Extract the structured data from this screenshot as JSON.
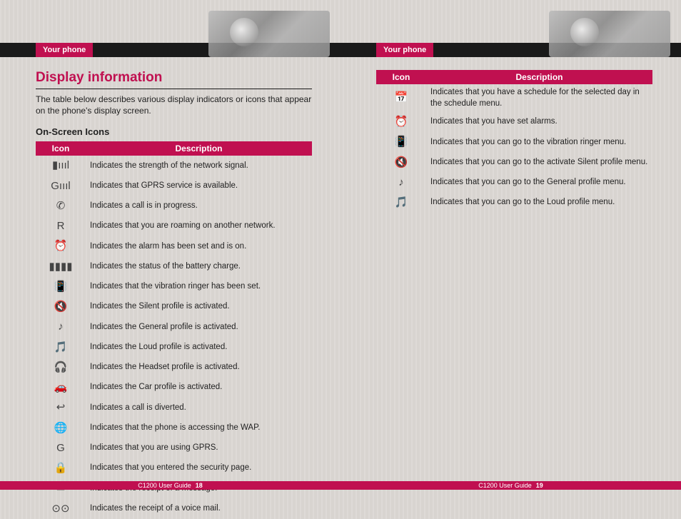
{
  "header": {
    "label": "Your phone"
  },
  "left": {
    "title": "Display information",
    "intro": "The table below describes various display indicators or icons that appear on the phone's display screen.",
    "subhead": "On-Screen Icons",
    "table": {
      "col_icon": "Icon",
      "col_desc": "Description",
      "rows": [
        {
          "icon": "signal-strength-icon",
          "glyph": "▮ıııl",
          "desc": "Indicates the strength of the network signal."
        },
        {
          "icon": "gprs-signal-icon",
          "glyph": "Gıııl",
          "desc": "Indicates that GPRS service is available."
        },
        {
          "icon": "call-in-progress-icon",
          "glyph": "✆",
          "desc": "Indicates a call is in progress."
        },
        {
          "icon": "roaming-icon",
          "glyph": "R",
          "desc": "Indicates that you are roaming on another network."
        },
        {
          "icon": "alarm-on-icon",
          "glyph": "⏰",
          "desc": "Indicates the alarm has been set and is on."
        },
        {
          "icon": "battery-icon",
          "glyph": "▮▮▮▮",
          "desc": "Indicates the status of the battery charge."
        },
        {
          "icon": "vibration-ringer-icon",
          "glyph": "📳",
          "desc": "Indicates that the vibration ringer has been set."
        },
        {
          "icon": "silent-profile-icon",
          "glyph": "🔇",
          "desc": "Indicates the Silent profile is activated."
        },
        {
          "icon": "general-profile-icon",
          "glyph": "♪",
          "desc": "Indicates the General profile is activated."
        },
        {
          "icon": "loud-profile-icon",
          "glyph": "🎵",
          "desc": "Indicates the Loud profile is activated."
        },
        {
          "icon": "headset-profile-icon",
          "glyph": "🎧",
          "desc": "Indicates the Headset profile is activated."
        },
        {
          "icon": "car-profile-icon",
          "glyph": "🚗",
          "desc": "Indicates the Car profile is activated."
        },
        {
          "icon": "call-diverted-icon",
          "glyph": "↩",
          "desc": "Indicates a call is diverted."
        },
        {
          "icon": "wap-access-icon",
          "glyph": "🌐",
          "desc": "Indicates that the phone is accessing the WAP."
        },
        {
          "icon": "gprs-in-use-icon",
          "glyph": "G",
          "desc": "Indicates that you are using GPRS."
        },
        {
          "icon": "security-page-icon",
          "glyph": "🔒",
          "desc": "Indicates that you entered the security page."
        },
        {
          "icon": "message-received-icon",
          "glyph": "✉",
          "desc": "Indicates the receipt of a message."
        },
        {
          "icon": "voicemail-icon",
          "glyph": "⊙⊙",
          "desc": "Indicates the receipt of a voice mail."
        }
      ]
    },
    "footer": {
      "guide": "C1200 User Guide",
      "page": "18"
    }
  },
  "right": {
    "table": {
      "col_icon": "Icon",
      "col_desc": "Description",
      "rows": [
        {
          "icon": "schedule-icon",
          "glyph": "📅",
          "desc": "Indicates that you have a schedule for the selected day in the schedule menu."
        },
        {
          "icon": "alarm-set-icon",
          "glyph": "⏰",
          "desc": "Indicates that you have set alarms."
        },
        {
          "icon": "vibration-ringer-menu-icon",
          "glyph": "📳",
          "desc": "Indicates that you can go to the vibration ringer menu."
        },
        {
          "icon": "silent-profile-menu-icon",
          "glyph": "🔇",
          "desc": "Indicates that you can go to the activate Silent profile menu."
        },
        {
          "icon": "general-profile-menu-icon",
          "glyph": "♪",
          "desc": "Indicates that you can go to the General profile menu."
        },
        {
          "icon": "loud-profile-menu-icon",
          "glyph": "🎵",
          "desc": "Indicates that you can go to the Loud profile menu."
        }
      ]
    },
    "footer": {
      "guide": "C1200 User Guide",
      "page": "19"
    }
  }
}
